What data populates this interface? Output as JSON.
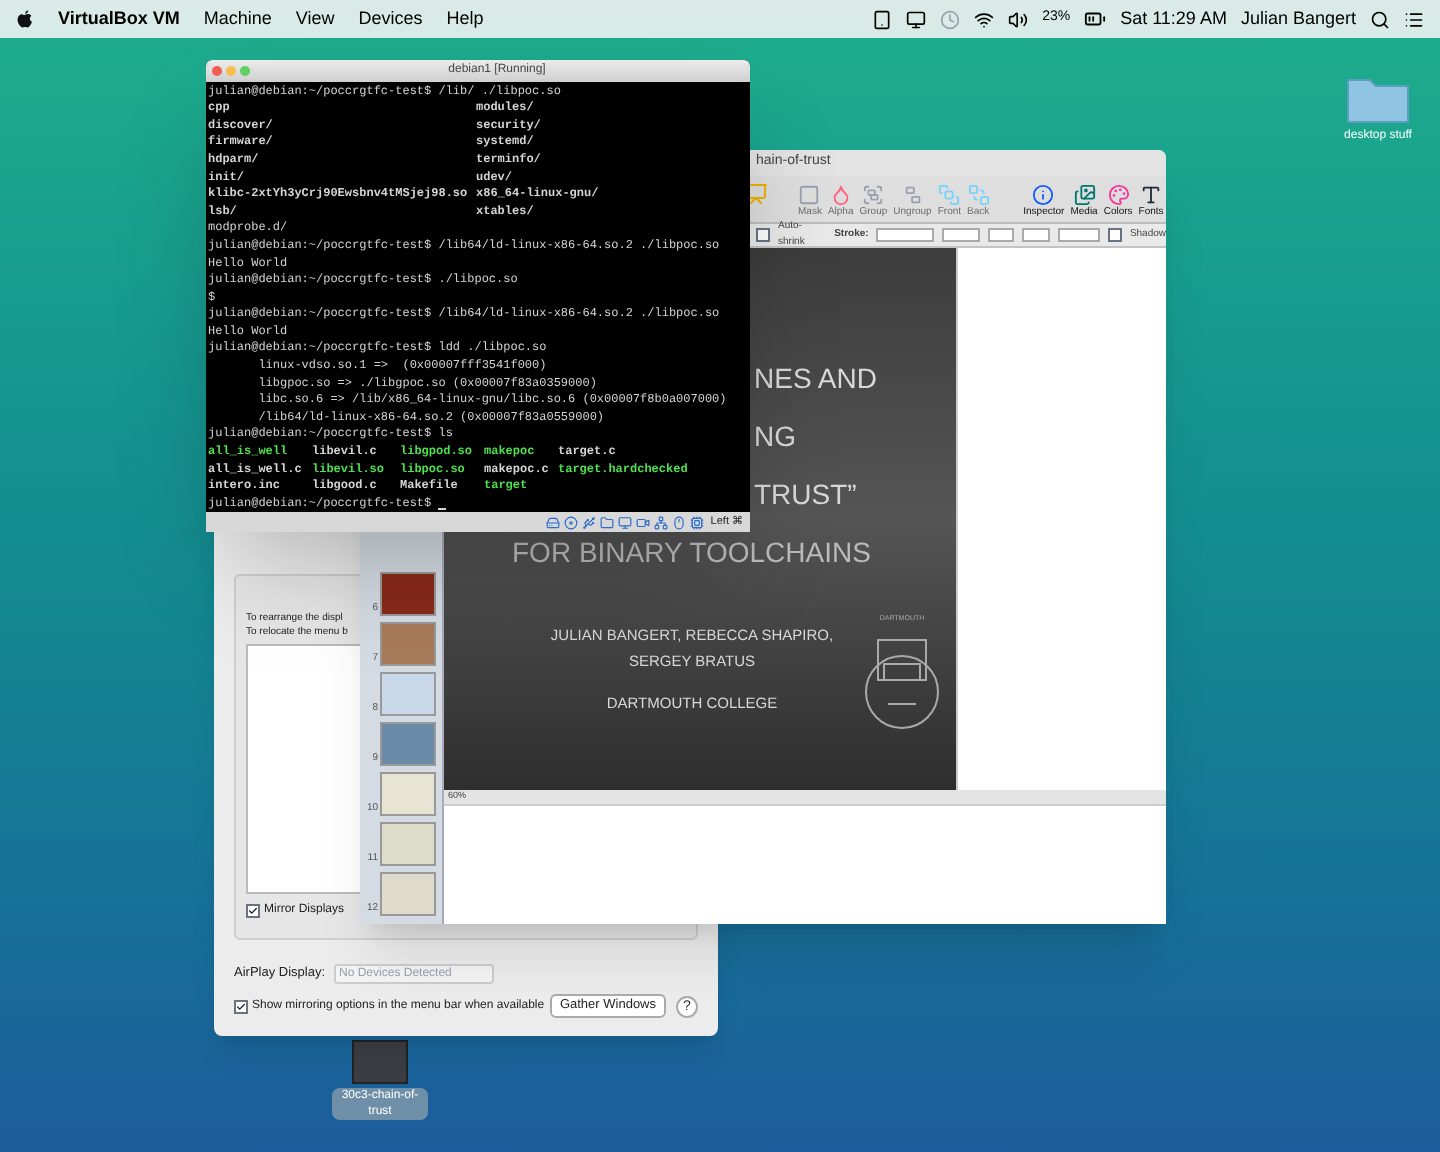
{
  "menu_bar": {
    "app": "VirtualBox VM",
    "menus": [
      "Machine",
      "View",
      "Devices",
      "Help"
    ],
    "battery": "23%",
    "clock": "Sat 11:29 AM",
    "user": "Julian Bangert"
  },
  "desktop_icons": [
    {
      "kind": "folder",
      "label": "desktop stuff"
    },
    {
      "kind": "document",
      "label": "30c3-chain-of-trust"
    }
  ],
  "display_prefs": {
    "hint_lines": [
      "To rearrange the displ",
      "To relocate the menu b"
    ],
    "mirror_displays": {
      "label": "Mirror Displays",
      "checked": true
    },
    "airplay": {
      "label": "AirPlay Display:",
      "value": "No Devices Detected"
    },
    "show_mirroring": {
      "label": "Show mirroring options in the menu bar when available",
      "checked": true
    },
    "gather_button": "Gather Windows",
    "help_button": "?"
  },
  "keynote": {
    "title": "hain-of-trust",
    "toolbar": [
      {
        "label": "Mask",
        "disabled": true
      },
      {
        "label": "Alpha",
        "disabled": true
      },
      {
        "label": "Group",
        "disabled": true
      },
      {
        "label": "Ungroup",
        "disabled": true
      },
      {
        "label": "Front",
        "disabled": true
      },
      {
        "label": "Back",
        "disabled": true
      },
      {
        "label": "Inspector",
        "disabled": false
      },
      {
        "label": "Media",
        "disabled": false
      },
      {
        "label": "Colors",
        "disabled": false
      },
      {
        "label": "Fonts",
        "disabled": false
      }
    ],
    "format_bar": {
      "auto_shrink": {
        "label": "Auto-shrink",
        "checked": false
      },
      "stroke_label": "Stroke:",
      "shadow": {
        "label": "Shadow",
        "checked": false
      }
    },
    "slides": [
      "6",
      "7",
      "8",
      "9",
      "10",
      "11",
      "12"
    ],
    "slide": {
      "title_visible": [
        "NES AND",
        "NG",
        "TRUST”"
      ],
      "title_last": "FOR BINARY TOOLCHAINS",
      "authors": [
        "JULIAN BANGERT, REBECCA SHAPIRO,",
        "SERGEY BRATUS"
      ],
      "affiliation": "DARTMOUTH COLLEGE",
      "seal_label": "DARTMOUTH"
    },
    "zoom": "60%"
  },
  "terminal": {
    "title": "debian1 [Running]",
    "lines": [
      {
        "kind": "text",
        "text": "julian@debian:~/poccrgtfc-test$ /lib/ ./libpoc.so"
      },
      {
        "kind": "columns",
        "cells": [
          {
            "text": "cpp",
            "color": "#d4d4d4"
          },
          {
            "text": "modules/",
            "color": "#d4d4d4"
          }
        ]
      },
      {
        "kind": "columns",
        "cells": [
          {
            "text": "discover/",
            "color": "#d4d4d4"
          },
          {
            "text": "security/",
            "color": "#d4d4d4"
          }
        ]
      },
      {
        "kind": "columns",
        "cells": [
          {
            "text": "firmware/",
            "color": "#d4d4d4"
          },
          {
            "text": "systemd/",
            "color": "#d4d4d4"
          }
        ]
      },
      {
        "kind": "columns",
        "cells": [
          {
            "text": "hdparm/",
            "color": "#d4d4d4"
          },
          {
            "text": "terminfo/",
            "color": "#d4d4d4"
          }
        ]
      },
      {
        "kind": "columns",
        "cells": [
          {
            "text": "init/",
            "color": "#d4d4d4"
          },
          {
            "text": "udev/",
            "color": "#d4d4d4"
          }
        ]
      },
      {
        "kind": "columns",
        "cells": [
          {
            "text": "klibc-2xtYh3yCrj90Ewsbnv4tMSjej98.so",
            "color": "#d4d4d4"
          },
          {
            "text": "x86_64-linux-gnu/",
            "color": "#d4d4d4"
          }
        ]
      },
      {
        "kind": "columns",
        "cells": [
          {
            "text": "lsb/",
            "color": "#d4d4d4"
          },
          {
            "text": "xtables/",
            "color": "#d4d4d4"
          }
        ]
      },
      {
        "kind": "text",
        "text": "modprobe.d/"
      },
      {
        "kind": "text",
        "text": "julian@debian:~/poccrgtfc-test$ /lib64/ld-linux-x86-64.so.2 ./libpoc.so"
      },
      {
        "kind": "text",
        "text": "Hello World"
      },
      {
        "kind": "text",
        "text": "julian@debian:~/poccrgtfc-test$ ./libpoc.so"
      },
      {
        "kind": "text",
        "text": "$"
      },
      {
        "kind": "text",
        "text": "julian@debian:~/poccrgtfc-test$ /lib64/ld-linux-x86-64.so.2 ./libpoc.so"
      },
      {
        "kind": "text",
        "text": "Hello World"
      },
      {
        "kind": "text",
        "text": "julian@debian:~/poccrgtfc-test$ ldd ./libpoc.so"
      },
      {
        "kind": "text",
        "text": "       linux-vdso.so.1 =>  (0x00007fff3541f000)"
      },
      {
        "kind": "text",
        "text": "       libgpoc.so => ./libgpoc.so (0x00007f83a0359000)"
      },
      {
        "kind": "text",
        "text": "       libc.so.6 => /lib/x86_64-linux-gnu/libc.so.6 (0x00007f8b0a007000)"
      },
      {
        "kind": "text",
        "text": "       /lib64/ld-linux-x86-64.so.2 (0x00007f83a0559000)"
      },
      {
        "kind": "text",
        "text": "julian@debian:~/poccrgtfc-test$ ls"
      },
      {
        "kind": "columns",
        "cells": [
          {
            "text": "all_is_well",
            "color": "#4ee04e"
          },
          {
            "text": "libevil.c",
            "color": "#d4d4d4"
          },
          {
            "text": "libgpod.so",
            "color": "#4ee04e"
          },
          {
            "text": "makepoc",
            "color": "#4ee04e"
          },
          {
            "text": "target.c",
            "color": "#d4d4d4"
          }
        ]
      },
      {
        "kind": "columns",
        "cells": [
          {
            "text": "all_is_well.c",
            "color": "#d4d4d4"
          },
          {
            "text": "libevil.so",
            "color": "#4ee04e"
          },
          {
            "text": "libpoc.so",
            "color": "#4ee04e"
          },
          {
            "text": "makepoc.c",
            "color": "#d4d4d4"
          },
          {
            "text": "target.hardchecked",
            "color": "#4ee04e"
          }
        ]
      },
      {
        "kind": "columns",
        "cells": [
          {
            "text": "intero.inc",
            "color": "#d4d4d4"
          },
          {
            "text": "libgood.c",
            "color": "#d4d4d4"
          },
          {
            "text": "Makefile",
            "color": "#d4d4d4"
          },
          {
            "text": "target",
            "color": "#4ee04e"
          }
        ]
      },
      {
        "kind": "prompt",
        "text": "julian@debian:~/poccrgtfc-test$ "
      }
    ],
    "host_key": "Left ⌘"
  }
}
